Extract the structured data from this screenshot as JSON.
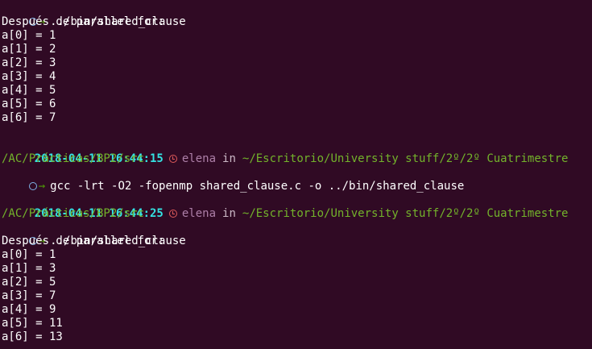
{
  "terminal": {
    "prompt_arrow": "→",
    "blocks": {
      "run1": {
        "command": "../bin/shared_clause",
        "header": "Después de parallel for:",
        "output": [
          "a[0] = 1",
          "a[1] = 2",
          "a[2] = 3",
          "a[3] = 4",
          "a[4] = 5",
          "a[5] = 6",
          "a[6] = 7"
        ]
      },
      "prompt2": {
        "timestamp": "2018-04-11 16:44:15",
        "user": "elena",
        "in": "in",
        "path_line1": "~/Escritorio/University stuff/2º/2º Cuatrimestre",
        "path_line2": "/AC/Prácticas/BP2/src",
        "command": "gcc -lrt -O2 -fopenmp shared_clause.c -o ../bin/shared_clause"
      },
      "prompt3": {
        "timestamp": "2018-04-11 16:44:25",
        "user": "elena",
        "in": "in",
        "path_line1": "~/Escritorio/University stuff/2º/2º Cuatrimestre",
        "path_line2": "/AC/Prácticas/BP2/src",
        "command": "../bin/shared_clause",
        "header": "Después de parallel for:",
        "output": [
          "a[0] = 1",
          "a[1] = 3",
          "a[2] = 5",
          "a[3] = 7",
          "a[4] = 9",
          "a[5] = 11",
          "a[6] = 13"
        ]
      }
    }
  }
}
